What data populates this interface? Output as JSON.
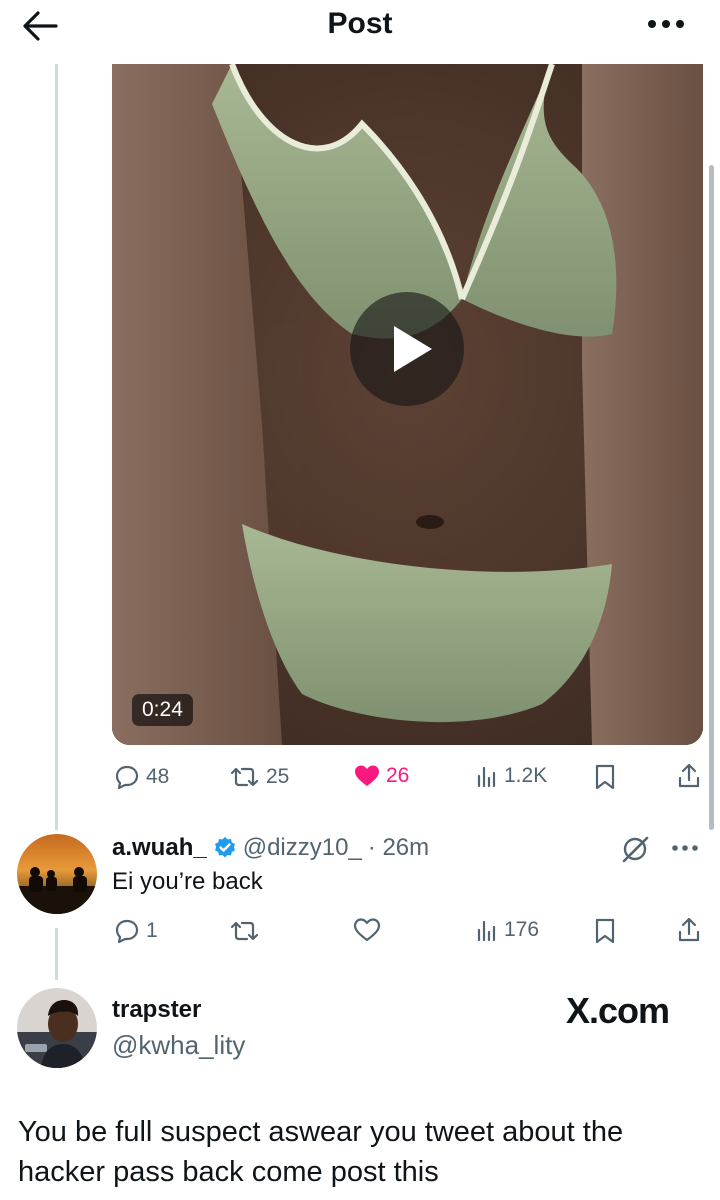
{
  "header": {
    "title": "Post"
  },
  "video": {
    "duration": "0:24"
  },
  "main_post": {
    "actions": {
      "replies": "48",
      "reposts": "25",
      "likes": "26",
      "views": "1.2K"
    }
  },
  "reply": {
    "name": "a.wuah_",
    "handle": "@dizzy10_",
    "time": "· 26m",
    "text": "Ei you’re back",
    "actions": {
      "replies": "1",
      "views": "176"
    }
  },
  "quote": {
    "name": "trapster",
    "handle": "@kwha_lity",
    "watermark": "X.com",
    "text": "You be full suspect aswear you tweet about the hacker pass back come post this"
  },
  "colors": {
    "like": "#f91880",
    "verified": "#1d9bf0",
    "muted": "#536471"
  }
}
